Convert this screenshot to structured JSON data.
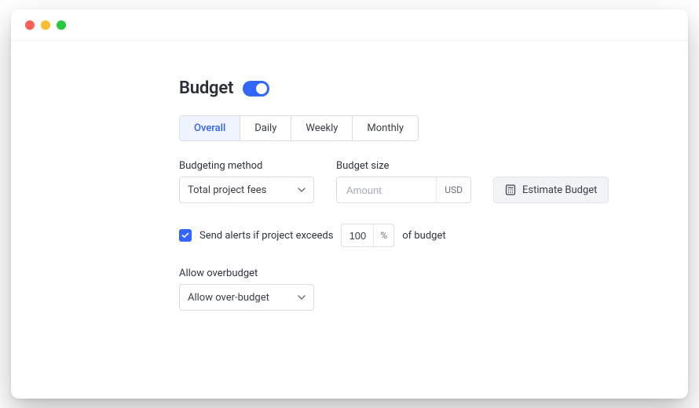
{
  "heading": "Budget",
  "toggle_on": true,
  "tabs": [
    "Overall",
    "Daily",
    "Weekly",
    "Monthly"
  ],
  "active_tab_index": 0,
  "budgeting_method": {
    "label": "Budgeting method",
    "value": "Total project fees"
  },
  "budget_size": {
    "label": "Budget size",
    "placeholder": "Amount",
    "unit": "USD"
  },
  "estimate_button_label": "Estimate Budget",
  "alerts": {
    "checked": true,
    "label_pre": "Send alerts if project exceeds",
    "value": "100",
    "unit": "%",
    "label_post": "of budget"
  },
  "overbudget": {
    "label": "Allow overbudget",
    "value": "Allow over-budget"
  }
}
